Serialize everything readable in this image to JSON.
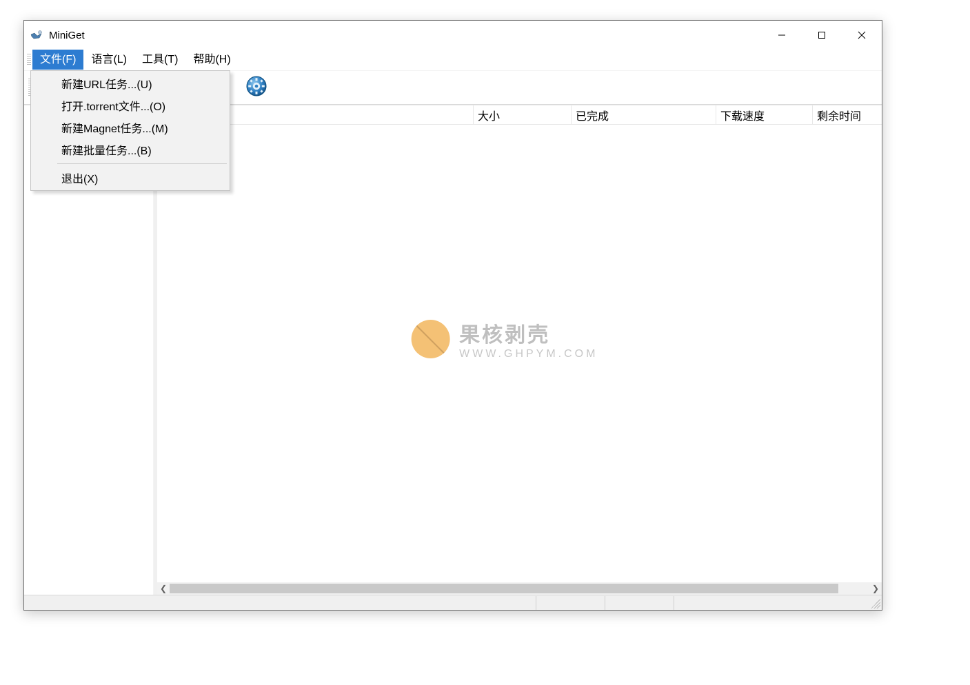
{
  "window": {
    "title": "MiniGet"
  },
  "menubar": {
    "items": [
      {
        "label": "文件(F)",
        "active": true
      },
      {
        "label": "语言(L)",
        "active": false
      },
      {
        "label": "工具(T)",
        "active": false
      },
      {
        "label": "帮助(H)",
        "active": false
      }
    ]
  },
  "file_menu": {
    "items": [
      "新建URL任务...(U)",
      "打开.torrent文件...(O)",
      "新建Magnet任务...(M)",
      "新建批量任务...(B)"
    ],
    "exit": "退出(X)"
  },
  "toolbar": {
    "settings_icon": "settings"
  },
  "columns": {
    "size": "大小",
    "completed": "已完成",
    "download_speed": "下载速度",
    "remaining_time": "剩余时间"
  },
  "watermark": {
    "title": "果核剥壳",
    "subtitle": "WWW.GHPYM.COM"
  }
}
